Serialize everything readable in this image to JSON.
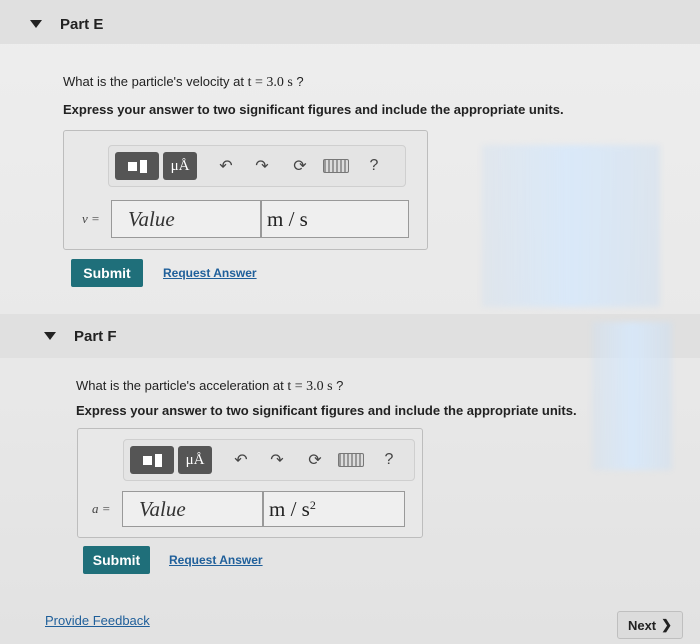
{
  "partE": {
    "title": "Part E",
    "question_prefix": "What is the particle's velocity at ",
    "question_math": "t = 3.0 s",
    "question_suffix": " ?",
    "instruction": "Express your answer to two significant figures and include the appropriate units.",
    "variable_label": "v =",
    "value_placeholder": "Value",
    "unit": "m / s",
    "unit_exponent": "",
    "submit_label": "Submit",
    "request_label": "Request Answer"
  },
  "partF": {
    "title": "Part F",
    "question_prefix": "What is the particle's acceleration at ",
    "question_math": "t = 3.0 s",
    "question_suffix": " ?",
    "instruction": "Express your answer to two significant figures and include the appropriate units.",
    "variable_label": "a =",
    "value_placeholder": "Value",
    "unit": "m / s",
    "unit_exponent": "2",
    "submit_label": "Submit",
    "request_label": "Request Answer"
  },
  "toolbar": {
    "units_symbol": "μÅ",
    "help_symbol": "?",
    "undo_symbol": "↶",
    "redo_symbol": "↷",
    "reset_symbol": "⟳"
  },
  "footer": {
    "feedback_label": "Provide Feedback",
    "next_label": "Next",
    "next_arrow": "❯"
  },
  "colors": {
    "submit": "#1f6f7a",
    "link": "#1f5f9a"
  }
}
